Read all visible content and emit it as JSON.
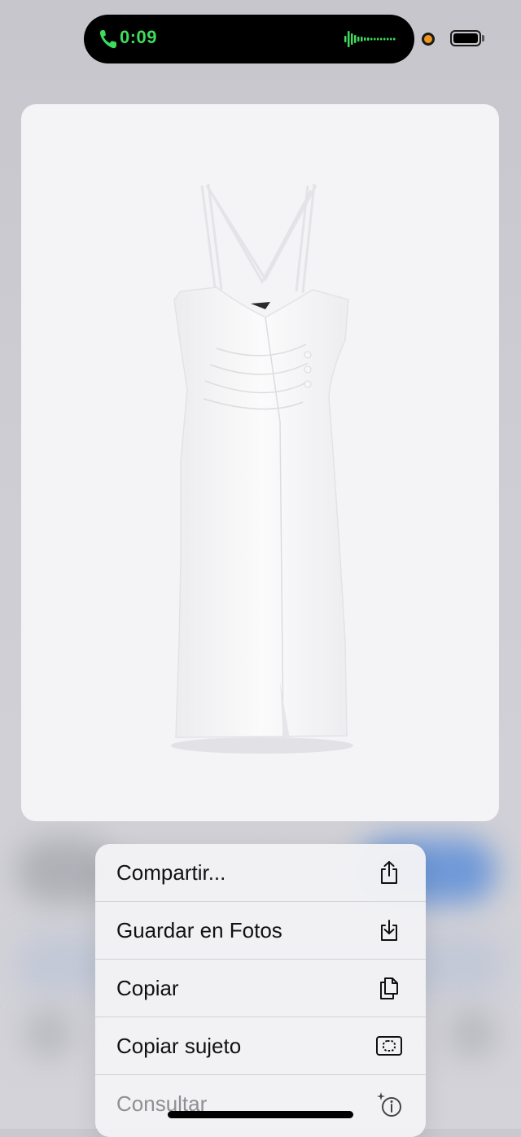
{
  "status_bar": {
    "call_time": "0:09",
    "accent_color": "#3ddc5b",
    "privacy_dot_color": "#f0951d"
  },
  "preview": {
    "image": "white-midi-dress-icon",
    "background": "#f4f4f6"
  },
  "context_menu": {
    "items": [
      {
        "label": "Compartir...",
        "icon": "share-icon",
        "enabled": true
      },
      {
        "label": "Guardar en Fotos",
        "icon": "save-to-photos-icon",
        "enabled": true
      },
      {
        "label": "Copiar",
        "icon": "copy-icon",
        "enabled": true
      },
      {
        "label": "Copiar sujeto",
        "icon": "copy-subject-icon",
        "enabled": true
      },
      {
        "label": "Consultar",
        "icon": "look-up-icon",
        "enabled": false
      }
    ]
  }
}
